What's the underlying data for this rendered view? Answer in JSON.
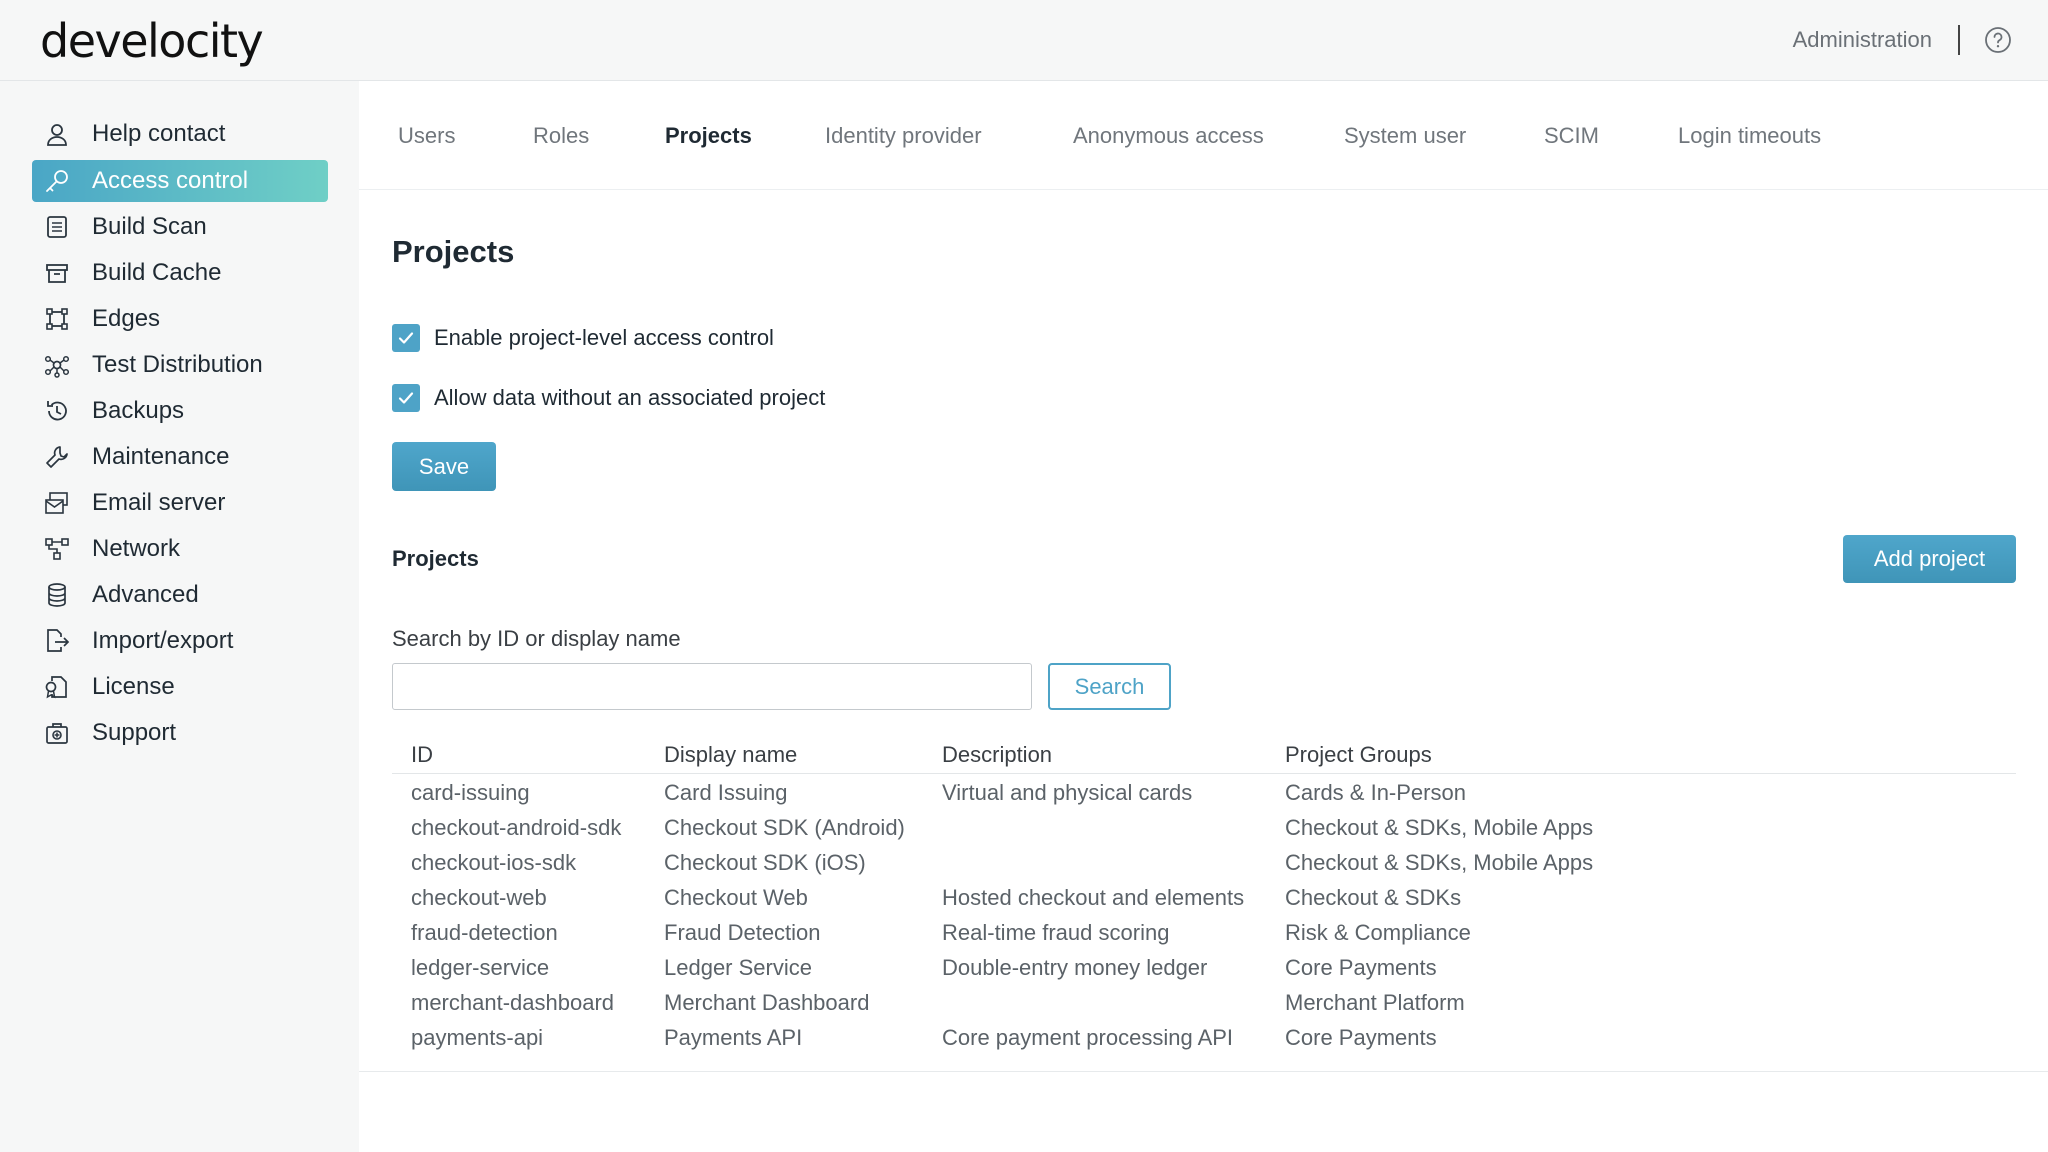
{
  "header": {
    "logo": "develocity",
    "admin_link": "Administration",
    "help_icon": "question-circle-icon"
  },
  "sidebar": {
    "items": [
      {
        "label": "Help contact",
        "icon": "person-icon",
        "active": false
      },
      {
        "label": "Access control",
        "icon": "key-icon",
        "active": true
      },
      {
        "label": "Build Scan",
        "icon": "list-document-icon",
        "active": false
      },
      {
        "label": "Build Cache",
        "icon": "archive-box-icon",
        "active": false
      },
      {
        "label": "Edges",
        "icon": "square-nodes-icon",
        "active": false
      },
      {
        "label": "Test Distribution",
        "icon": "network-hub-icon",
        "active": false
      },
      {
        "label": "Backups",
        "icon": "history-icon",
        "active": false
      },
      {
        "label": "Maintenance",
        "icon": "wrench-icon",
        "active": false
      },
      {
        "label": "Email server",
        "icon": "email-server-icon",
        "active": false
      },
      {
        "label": "Network",
        "icon": "network-icon",
        "active": false
      },
      {
        "label": "Advanced",
        "icon": "database-icon",
        "active": false
      },
      {
        "label": "Import/export",
        "icon": "file-export-icon",
        "active": false
      },
      {
        "label": "License",
        "icon": "license-icon",
        "active": false
      },
      {
        "label": "Support",
        "icon": "support-icon",
        "active": false
      }
    ]
  },
  "tabs": [
    {
      "label": "Users",
      "active": false
    },
    {
      "label": "Roles",
      "active": false
    },
    {
      "label": "Projects",
      "active": true
    },
    {
      "label": "Identity provider",
      "active": false
    },
    {
      "label": "Anonymous access",
      "active": false
    },
    {
      "label": "System user",
      "active": false
    },
    {
      "label": "SCIM",
      "active": false
    },
    {
      "label": "Login timeouts",
      "active": false
    }
  ],
  "main": {
    "title": "Projects",
    "options": [
      {
        "label": "Enable project-level access control",
        "checked": true
      },
      {
        "label": "Allow data without an associated project",
        "checked": true
      }
    ],
    "save_label": "Save",
    "projects_section_title": "Projects",
    "add_project_label": "Add project",
    "search_label": "Search by ID or display name",
    "search_value": "",
    "search_placeholder": "",
    "search_button_label": "Search"
  },
  "table": {
    "headers": [
      "ID",
      "Display name",
      "Description",
      "Project Groups"
    ],
    "rows": [
      [
        "card-issuing",
        "Card Issuing",
        "Virtual and physical cards",
        "Cards & In-Person"
      ],
      [
        "checkout-android-sdk",
        "Checkout SDK (Android)",
        "",
        "Checkout & SDKs, Mobile Apps"
      ],
      [
        "checkout-ios-sdk",
        "Checkout SDK (iOS)",
        "",
        "Checkout & SDKs, Mobile Apps"
      ],
      [
        "checkout-web",
        "Checkout Web",
        "Hosted checkout and elements",
        "Checkout & SDKs"
      ],
      [
        "fraud-detection",
        "Fraud Detection",
        "Real-time fraud scoring",
        "Risk & Compliance"
      ],
      [
        "ledger-service",
        "Ledger Service",
        "Double-entry money ledger",
        "Core Payments"
      ],
      [
        "merchant-dashboard",
        "Merchant Dashboard",
        "",
        "Merchant Platform"
      ],
      [
        "payments-api",
        "Payments API",
        "Core payment processing API",
        "Core Payments"
      ]
    ]
  },
  "colors": {
    "accent": "#4ea3c7",
    "accent_gradient_end": "#6fcfc6",
    "sidebar_bg": "#f6f7f7",
    "text_dark": "#1f2a33",
    "text_muted": "#5b6268"
  }
}
